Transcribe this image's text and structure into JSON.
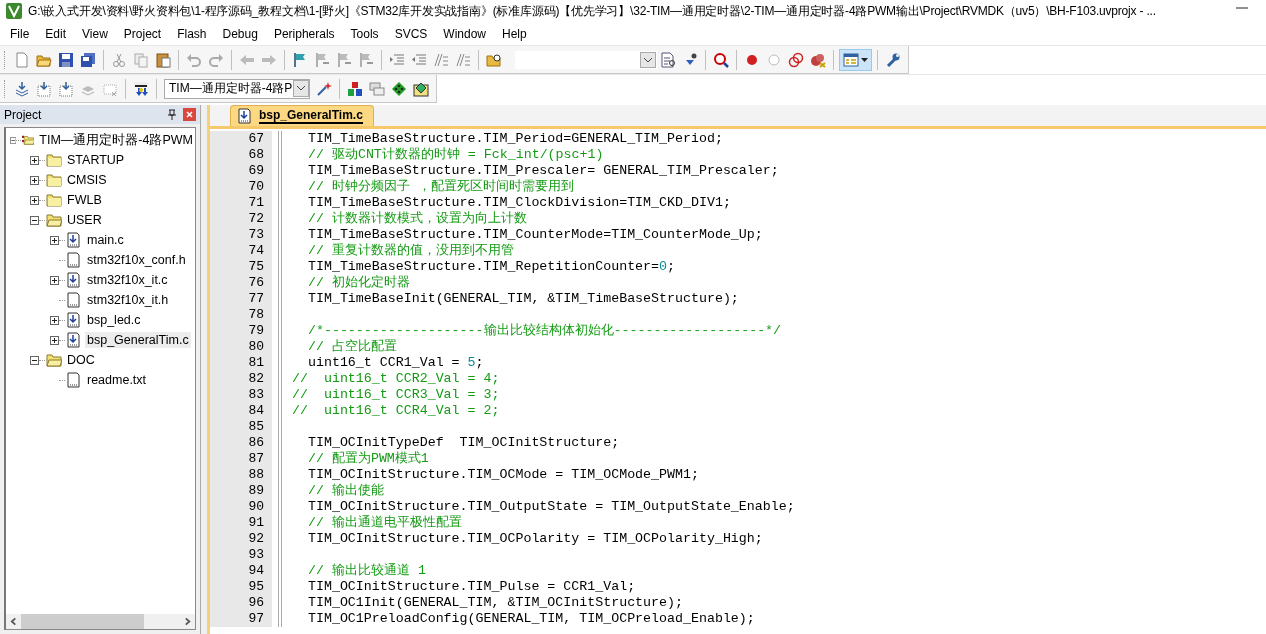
{
  "window": {
    "title": "G:\\嵌入式开发\\资料\\野火资料包\\1-程序源码_教程文档\\1-[野火]《STM32库开发实战指南》(标准库源码)【优先学习】\\32-TIM—通用定时器\\2-TIM—通用定时器-4路PWM输出\\Project\\RVMDK（uv5）\\BH-F103.uvprojx - ..."
  },
  "menu": [
    "File",
    "Edit",
    "View",
    "Project",
    "Flash",
    "Debug",
    "Peripherals",
    "Tools",
    "SVCS",
    "Window",
    "Help"
  ],
  "target_select": {
    "value": "TIM—通用定时器-4路P"
  },
  "project_panel": {
    "title": "Project",
    "tree": [
      {
        "label": "TIM—通用定时器-4路PWM",
        "kind": "project",
        "expanded": true,
        "selected": false,
        "children": [
          {
            "label": "STARTUP",
            "kind": "group",
            "expanded": false,
            "selected": false
          },
          {
            "label": "CMSIS",
            "kind": "group",
            "expanded": false,
            "selected": false
          },
          {
            "label": "FWLB",
            "kind": "group",
            "expanded": false,
            "selected": false
          },
          {
            "label": "USER",
            "kind": "group",
            "expanded": true,
            "selected": false,
            "children": [
              {
                "label": "main.c",
                "kind": "source",
                "expanded": false,
                "selected": false
              },
              {
                "label": "stm32f10x_conf.h",
                "kind": "header",
                "selected": false
              },
              {
                "label": "stm32f10x_it.c",
                "kind": "source",
                "expanded": false,
                "selected": false
              },
              {
                "label": "stm32f10x_it.h",
                "kind": "header",
                "selected": false
              },
              {
                "label": "bsp_led.c",
                "kind": "source",
                "expanded": false,
                "selected": false
              },
              {
                "label": "bsp_GeneralTim.c",
                "kind": "source",
                "expanded": false,
                "selected": true
              }
            ]
          },
          {
            "label": "DOC",
            "kind": "group",
            "expanded": true,
            "selected": false,
            "children": [
              {
                "label": "readme.txt",
                "kind": "header",
                "selected": false
              }
            ]
          }
        ]
      }
    ]
  },
  "editor": {
    "tabs": [
      {
        "label": "bsp_GeneralTim.c",
        "selected": true
      }
    ],
    "lines": [
      {
        "number": "67",
        "parts": [
          {
            "kind": "code",
            "text": "  TIM_TimeBaseStructure.TIM_Period=GENERAL_TIM_Period;"
          }
        ]
      },
      {
        "number": "68",
        "parts": [
          {
            "kind": "comment",
            "text": "  // 驱动CNT计数器的时钟 = Fck_int/(psc+1)"
          }
        ]
      },
      {
        "number": "69",
        "parts": [
          {
            "kind": "code",
            "text": "  TIM_TimeBaseStructure.TIM_Prescaler= GENERAL_TIM_Prescaler;"
          }
        ]
      },
      {
        "number": "70",
        "parts": [
          {
            "kind": "comment",
            "text": "  // 时钟分频因子 ，配置死区时间时需要用到"
          }
        ]
      },
      {
        "number": "71",
        "parts": [
          {
            "kind": "code",
            "text": "  TIM_TimeBaseStructure.TIM_ClockDivision=TIM_CKD_DIV1;"
          }
        ]
      },
      {
        "number": "72",
        "parts": [
          {
            "kind": "comment",
            "text": "  // 计数器计数模式，设置为向上计数"
          }
        ]
      },
      {
        "number": "73",
        "parts": [
          {
            "kind": "code",
            "text": "  TIM_TimeBaseStructure.TIM_CounterMode=TIM_CounterMode_Up;"
          }
        ]
      },
      {
        "number": "74",
        "parts": [
          {
            "kind": "comment",
            "text": "  // 重复计数器的值，没用到不用管"
          }
        ]
      },
      {
        "number": "75",
        "parts": [
          {
            "kind": "code",
            "text": "  TIM_TimeBaseStructure.TIM_RepetitionCounter="
          },
          {
            "kind": "number",
            "text": "0"
          },
          {
            "kind": "code",
            "text": ";"
          }
        ]
      },
      {
        "number": "76",
        "parts": [
          {
            "kind": "comment",
            "text": "  // 初始化定时器"
          }
        ]
      },
      {
        "number": "77",
        "parts": [
          {
            "kind": "code",
            "text": "  TIM_TimeBaseInit(GENERAL_TIM, &TIM_TimeBaseStructure);"
          }
        ]
      },
      {
        "number": "78"
      },
      {
        "number": "79",
        "parts": [
          {
            "kind": "comment",
            "text": "  /*--------------------输出比较结构体初始化-------------------*/"
          }
        ]
      },
      {
        "number": "80",
        "parts": [
          {
            "kind": "comment",
            "text": "  // 占空比配置"
          }
        ]
      },
      {
        "number": "81",
        "parts": [
          {
            "kind": "code",
            "text": "  uint16_t CCR1_Val = "
          },
          {
            "kind": "number",
            "text": "5"
          },
          {
            "kind": "code",
            "text": ";"
          }
        ]
      },
      {
        "number": "82",
        "parts": [
          {
            "kind": "comment",
            "text": "//  uint16_t CCR2_Val = 4;"
          }
        ]
      },
      {
        "number": "83",
        "parts": [
          {
            "kind": "comment",
            "text": "//  uint16_t CCR3_Val = 3;"
          }
        ]
      },
      {
        "number": "84",
        "parts": [
          {
            "kind": "comment",
            "text": "//  uint16_t CCR4_Val = 2;"
          }
        ]
      },
      {
        "number": "85"
      },
      {
        "number": "86",
        "parts": [
          {
            "kind": "code",
            "text": "  TIM_OCInitTypeDef  TIM_OCInitStructure;"
          }
        ]
      },
      {
        "number": "87",
        "parts": [
          {
            "kind": "comment",
            "text": "  // 配置为PWM模式1"
          }
        ]
      },
      {
        "number": "88",
        "parts": [
          {
            "kind": "code",
            "text": "  TIM_OCInitStructure.TIM_OCMode = TIM_OCMode_PWM1;"
          }
        ]
      },
      {
        "number": "89",
        "parts": [
          {
            "kind": "comment",
            "text": "  // 输出使能"
          }
        ]
      },
      {
        "number": "90",
        "parts": [
          {
            "kind": "code",
            "text": "  TIM_OCInitStructure.TIM_OutputState = TIM_OutputState_Enable;"
          }
        ]
      },
      {
        "number": "91",
        "parts": [
          {
            "kind": "comment",
            "text": "  // 输出通道电平极性配置"
          }
        ]
      },
      {
        "number": "92",
        "parts": [
          {
            "kind": "code",
            "text": "  TIM_OCInitStructure.TIM_OCPolarity = TIM_OCPolarity_High;"
          }
        ]
      },
      {
        "number": "93"
      },
      {
        "number": "94",
        "parts": [
          {
            "kind": "comment",
            "text": "  // 输出比较通道 1"
          }
        ]
      },
      {
        "number": "95",
        "parts": [
          {
            "kind": "code",
            "text": "  TIM_OCInitStructure.TIM_Pulse = CCR1_Val;"
          }
        ]
      },
      {
        "number": "96",
        "parts": [
          {
            "kind": "code",
            "text": "  TIM_OC1Init(GENERAL_TIM, &TIM_OCInitStructure);"
          }
        ]
      },
      {
        "number": "97",
        "parts": [
          {
            "kind": "code",
            "text": "  TIM_OC1PreloadConfig(GENERAL_TIM, TIM_OCPreload_Enable);"
          }
        ]
      }
    ]
  }
}
